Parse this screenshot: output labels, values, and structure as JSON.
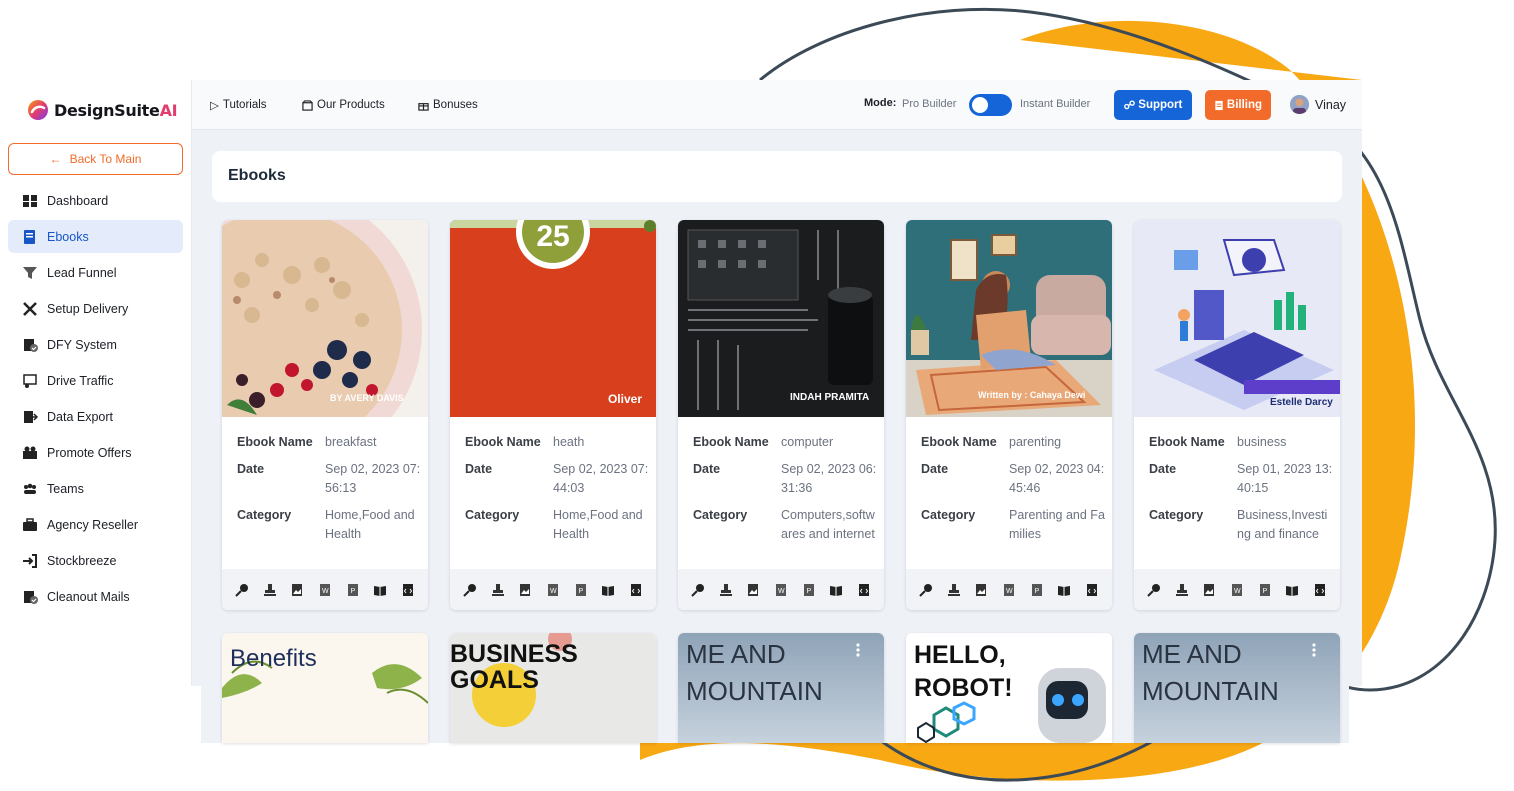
{
  "brand": {
    "name_main": "DesignSuite",
    "name_accent": "AI"
  },
  "sidebar": {
    "back_label": "Back To Main",
    "items": [
      {
        "label": "Dashboard",
        "icon": "dashboard-icon"
      },
      {
        "label": "Ebooks",
        "icon": "book-icon"
      },
      {
        "label": "Lead Funnel",
        "icon": "funnel-icon"
      },
      {
        "label": "Setup Delivery",
        "icon": "tools-icon"
      },
      {
        "label": "DFY System",
        "icon": "checklist-icon"
      },
      {
        "label": "Drive Traffic",
        "icon": "presentation-icon"
      },
      {
        "label": "Data Export",
        "icon": "export-icon"
      },
      {
        "label": "Promote Offers",
        "icon": "promote-icon"
      },
      {
        "label": "Teams",
        "icon": "teams-icon"
      },
      {
        "label": "Agency Reseller",
        "icon": "briefcase-icon"
      },
      {
        "label": "Stockbreeze",
        "icon": "login-icon"
      },
      {
        "label": "Cleanout Mails",
        "icon": "mail-check-icon"
      }
    ]
  },
  "topbar": {
    "tutorials": "Tutorials",
    "products": "Our Products",
    "bonuses": "Bonuses",
    "mode_label": "Mode:",
    "mode_pro": "Pro Builder",
    "mode_instant": "Instant Builder",
    "mode_instant_on": true,
    "support": "Support",
    "billing": "Billing",
    "user": "Vinay"
  },
  "page": {
    "title": "Ebooks"
  },
  "labels": {
    "name": "Ebook Name",
    "date": "Date",
    "category": "Category"
  },
  "ebooks": [
    {
      "name": "breakfast",
      "date": "Sep 02, 2023 07:56:13",
      "category": "Home,Food and Health",
      "author": "BY AVERY DAVIS"
    },
    {
      "name": "heath",
      "date": "Sep 02, 2023 07:44:03",
      "category": "Home,Food and Health",
      "author": "Oliver",
      "badge": "25"
    },
    {
      "name": "computer",
      "date": "Sep 02, 2023 06:31:36",
      "category": "Computers,softwares and internet",
      "author": "INDAH PRAMITA"
    },
    {
      "name": "parenting",
      "date": "Sep 02, 2023 04:45:46",
      "category": "Parenting and Families",
      "author": "Written by : Cahaya Dewi"
    },
    {
      "name": "business",
      "date": "Sep 01, 2023 13:40:15",
      "category": "Business,Investing and finance",
      "author": "Estelle Darcy"
    }
  ],
  "covers_row2": [
    {
      "line1": "Benefits",
      "line2": ""
    },
    {
      "line1": "BUSINESS",
      "line2": "GOALS"
    },
    {
      "line1": "ME AND",
      "line2": "MOUNTAIN"
    },
    {
      "line1": "HELLO,",
      "line2": "ROBOT!"
    },
    {
      "line1": "ME AND",
      "line2": "MOUNTAIN"
    }
  ],
  "action_icons": [
    "key-icon",
    "stamp-icon",
    "image-file-icon",
    "word-file-icon",
    "pdf-file-icon",
    "open-book-icon",
    "code-file-icon"
  ],
  "colors": {
    "primary": "#1565d8",
    "accent": "#f26b2a",
    "blob": "#f8a813"
  }
}
